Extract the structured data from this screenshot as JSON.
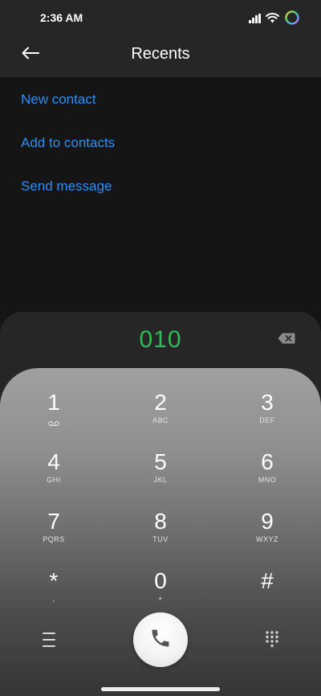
{
  "status_bar": {
    "time": "2:36 AM",
    "icons": [
      "signal-icon",
      "wifi-icon",
      "ring-indicator-icon"
    ]
  },
  "app_bar": {
    "back_icon": "arrow-left-icon",
    "title": "Recents"
  },
  "actions": [
    {
      "label": "New contact"
    },
    {
      "label": "Add to contacts"
    },
    {
      "label": "Send message"
    }
  ],
  "dialer": {
    "number": "010",
    "number_color": "#2dbd57",
    "backspace_icon": "backspace-icon",
    "keys": [
      {
        "digit": "1",
        "sub": ""
      },
      {
        "digit": "2",
        "sub": "ABC"
      },
      {
        "digit": "3",
        "sub": "DEF"
      },
      {
        "digit": "4",
        "sub": "GHI"
      },
      {
        "digit": "5",
        "sub": "JKL"
      },
      {
        "digit": "6",
        "sub": "MNO"
      },
      {
        "digit": "7",
        "sub": "PQRS"
      },
      {
        "digit": "8",
        "sub": "TUV"
      },
      {
        "digit": "9",
        "sub": "WXYZ"
      },
      {
        "digit": "*",
        "sub": ","
      },
      {
        "digit": "0",
        "sub": "+"
      },
      {
        "digit": "#",
        "sub": ""
      }
    ],
    "voicemail_icon": "voicemail-icon",
    "menu_icon": "menu-icon",
    "call_icon": "phone-icon",
    "dialpad_icon": "dialpad-icon"
  },
  "colors": {
    "accent_link": "#2f8ef0",
    "background": "#151515",
    "header": "#262626"
  }
}
